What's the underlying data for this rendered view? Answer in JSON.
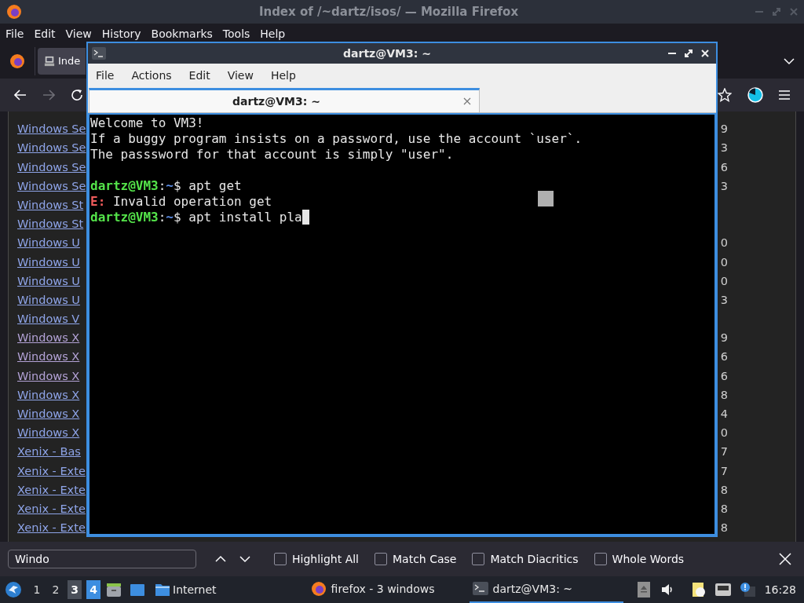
{
  "window": {
    "title": "Index of /~dartz/isos/ — Mozilla Firefox"
  },
  "menu": [
    "File",
    "Edit",
    "View",
    "History",
    "Bookmarks",
    "Tools",
    "Help"
  ],
  "tabs": [
    {
      "label": "Inde",
      "selected": true
    }
  ],
  "listing": [
    {
      "link": "Windows Se",
      "visited": false,
      "column_2": "9"
    },
    {
      "link": "Windows Se",
      "visited": false,
      "column_2": "3"
    },
    {
      "link": "Windows Se",
      "visited": false,
      "column_2": "6"
    },
    {
      "link": "Windows Se",
      "visited": false,
      "column_2": "3"
    },
    {
      "link": "Windows St",
      "visited": false
    },
    {
      "link": "Windows St",
      "visited": false
    },
    {
      "link": "Windows U",
      "visited": false,
      "column_2": "0"
    },
    {
      "link": "Windows U",
      "visited": false,
      "column_2": "0"
    },
    {
      "link": "Windows U",
      "visited": false,
      "column_2": "0"
    },
    {
      "link": "Windows U",
      "visited": false,
      "column_2": "3"
    },
    {
      "link": "Windows V",
      "visited": false
    },
    {
      "link": "Windows X",
      "visited": true,
      "column_2": "9"
    },
    {
      "link": "Windows X",
      "visited": true,
      "column_2": "6"
    },
    {
      "link": "Windows X",
      "visited": true,
      "column_2": "6"
    },
    {
      "link": "Windows X",
      "visited": false,
      "column_2": "8"
    },
    {
      "link": "Windows X",
      "visited": false,
      "column_2": "4"
    },
    {
      "link": "Windows X",
      "visited": false,
      "column_2": "0"
    },
    {
      "link": "Xenix - Bas",
      "visited": false,
      "column_2": "7"
    },
    {
      "link": "Xenix - Exte",
      "visited": false,
      "column_2": "7"
    },
    {
      "link": "Xenix - Exte",
      "visited": false,
      "column_2": "8"
    },
    {
      "link": "Xenix - Exte",
      "visited": false,
      "column_2": "8"
    },
    {
      "link": "Xenix - Exte",
      "visited": false,
      "column_2": "8"
    }
  ],
  "find_bar": {
    "value": "Windo",
    "options": [
      {
        "label": "Highlight All",
        "checked": false
      },
      {
        "label": "Match Case",
        "checked": false
      },
      {
        "label": "Match Diacritics",
        "checked": false
      },
      {
        "label": "Whole Words",
        "checked": false
      }
    ]
  },
  "terminal": {
    "title": "dartz@VM3: ~",
    "menu": [
      "File",
      "Actions",
      "Edit",
      "View",
      "Help"
    ],
    "tabs": [
      {
        "label": "dartz@VM3: ~",
        "selected": true
      }
    ],
    "lines": [
      {
        "kind": "text",
        "spans": [
          {
            "kind": "plain",
            "text": "Welcome to VM3!"
          }
        ]
      },
      {
        "kind": "text",
        "spans": [
          {
            "kind": "plain",
            "text": "If a buggy program insists on a password, use the account `user`."
          }
        ]
      },
      {
        "kind": "text",
        "spans": [
          {
            "kind": "plain",
            "text": "The passsword for that account is simply \"user\"."
          }
        ]
      },
      {
        "kind": "blank"
      },
      {
        "kind": "text",
        "spans": [
          {
            "kind": "user",
            "text": "dartz@VM3"
          },
          {
            "kind": "plain",
            "text": ":"
          },
          {
            "kind": "path",
            "text": "~"
          },
          {
            "kind": "plain",
            "text": "$ apt get"
          }
        ]
      },
      {
        "kind": "text",
        "spans": [
          {
            "kind": "error",
            "text": "E:"
          },
          {
            "kind": "plain",
            "text": " Invalid operation get"
          }
        ]
      },
      {
        "kind": "text",
        "cursor": true,
        "spans": [
          {
            "kind": "user",
            "text": "dartz@VM3"
          },
          {
            "kind": "plain",
            "text": ":"
          },
          {
            "kind": "path",
            "text": "~"
          },
          {
            "kind": "plain",
            "text": "$ apt install pla"
          }
        ]
      }
    ]
  },
  "taskbar": {
    "desktops": [
      {
        "label": "1",
        "selected": false,
        "occupied": false
      },
      {
        "label": "2",
        "selected": false,
        "occupied": false
      },
      {
        "label": "3",
        "selected": false,
        "occupied": true
      },
      {
        "label": "4",
        "selected": true,
        "occupied": true
      }
    ],
    "launcher": "Internet",
    "tasks": [
      {
        "label": "firefox - 3 windows",
        "kind": "browser",
        "selected": false
      },
      {
        "label": "dartz@VM3: ~",
        "kind": "terminal",
        "selected": true
      }
    ],
    "clock": "16:28"
  }
}
